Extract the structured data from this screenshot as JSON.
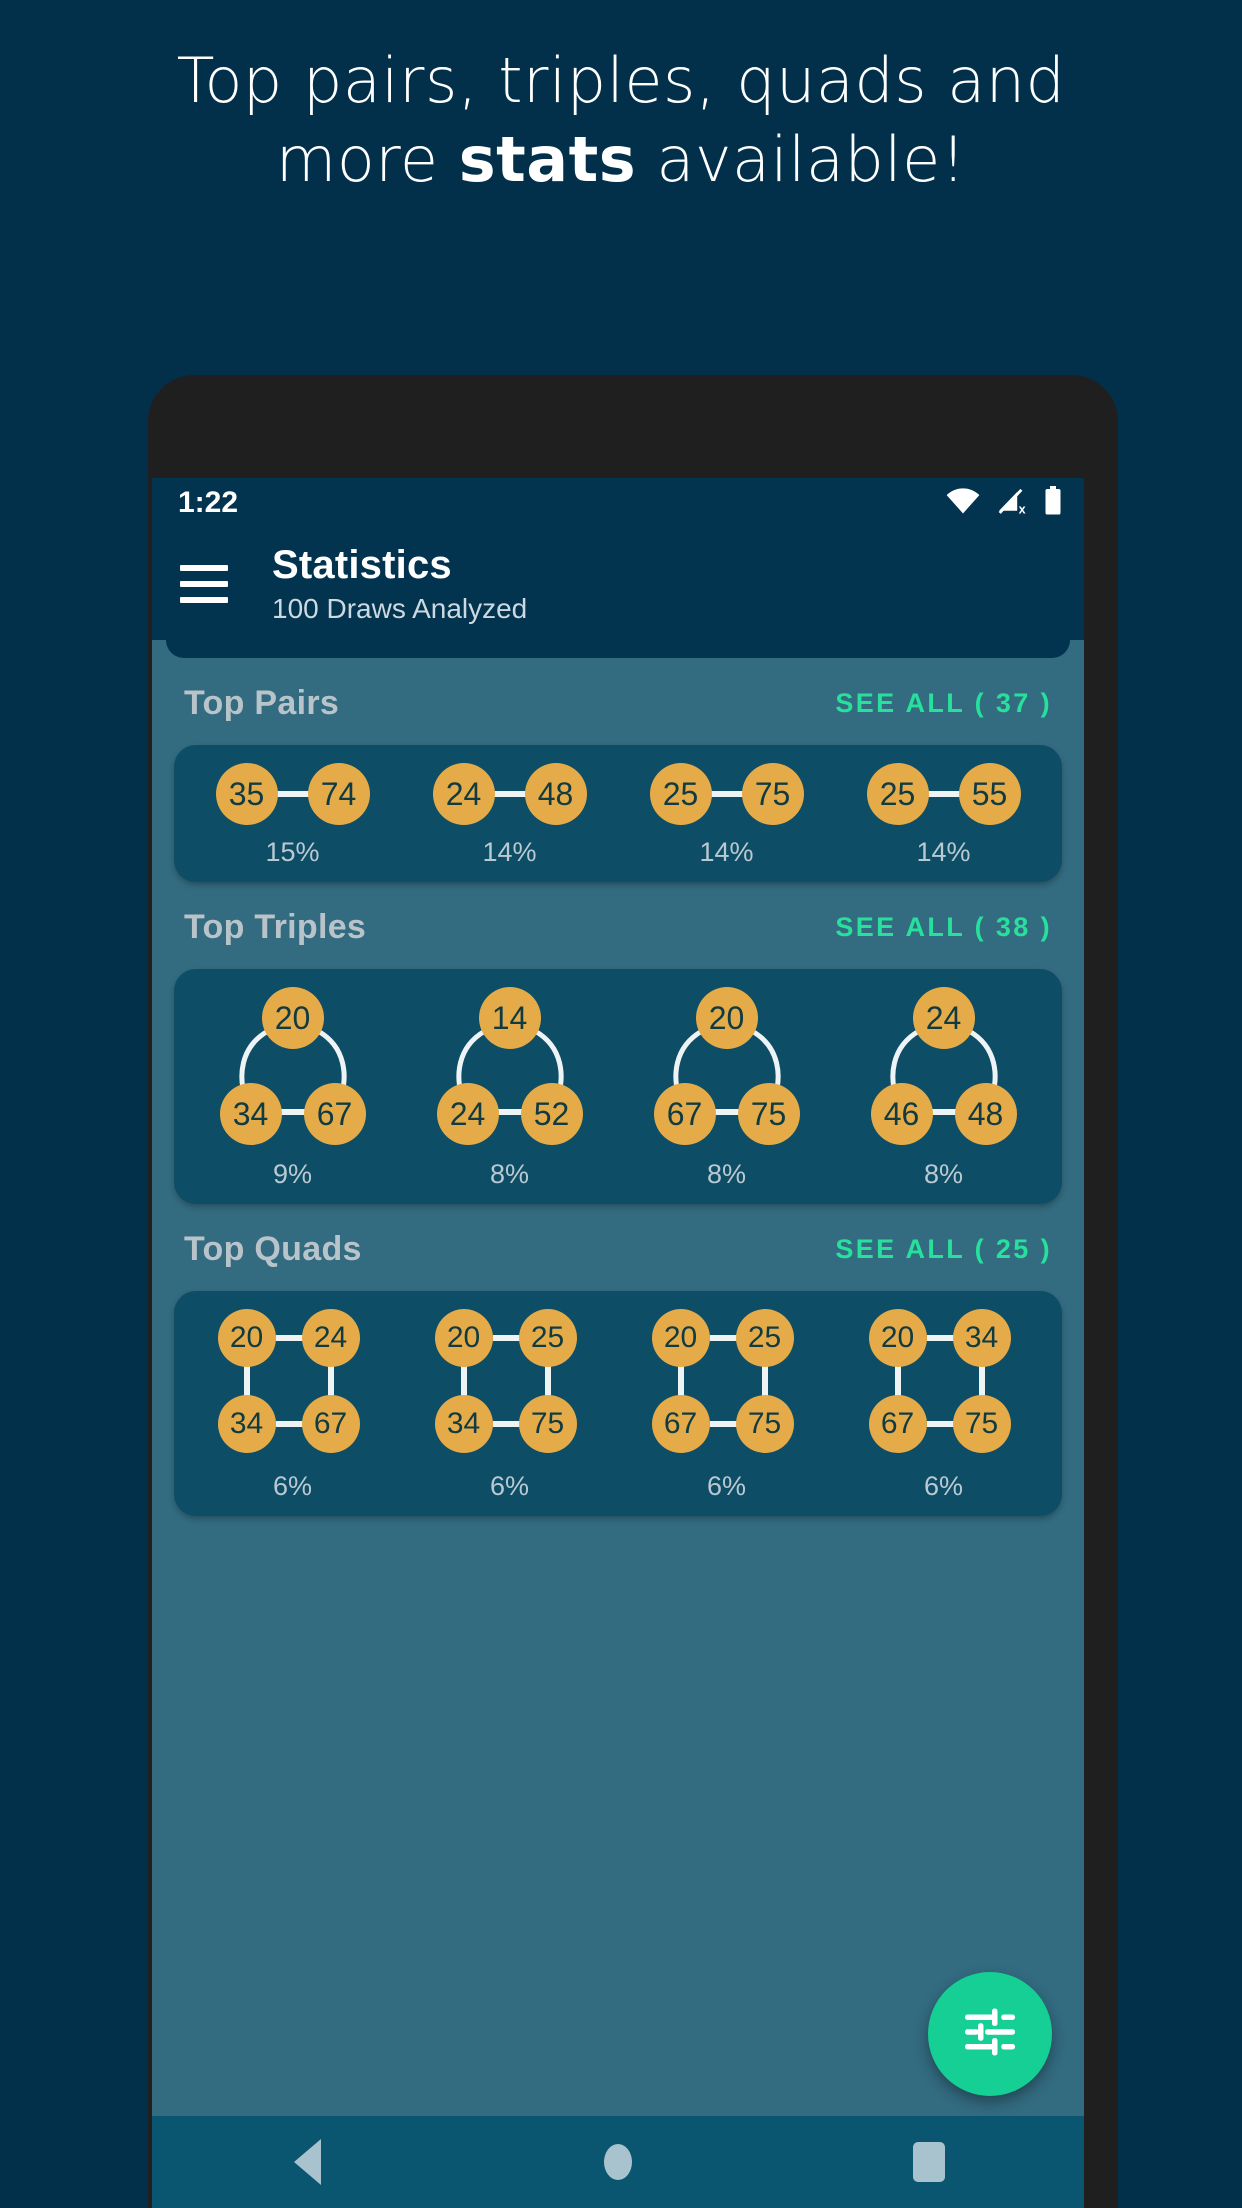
{
  "promo": {
    "line1": "Top pairs, triples, quads and",
    "line2_pre": "more ",
    "line2_bold": "stats",
    "line2_post": " available!"
  },
  "status_bar": {
    "time": "1:22",
    "icons": [
      "wifi-icon",
      "signal-off-icon",
      "battery-icon"
    ]
  },
  "app_bar": {
    "menu_icon": "hamburger-menu-icon",
    "title": "Statistics",
    "subtitle": "100 Draws Analyzed"
  },
  "colors": {
    "page_bg": "#02304a",
    "app_bar": "#02334f",
    "content_bg": "#336b80",
    "card_bg": "#0d4d66",
    "ball": "#e5ab48",
    "ball_text": "#113b42",
    "accent": "#27e09b",
    "fab": "#16cf94",
    "link": "#eef4f6",
    "nav_bar": "#0a5570"
  },
  "sections": [
    {
      "id": "top-pairs",
      "title": "Top Pairs",
      "see_all": "SEE ALL ( 37 )",
      "kind": "pair",
      "items": [
        {
          "numbers": [
            "35",
            "74"
          ],
          "percent": "15%"
        },
        {
          "numbers": [
            "24",
            "48"
          ],
          "percent": "14%"
        },
        {
          "numbers": [
            "25",
            "75"
          ],
          "percent": "14%"
        },
        {
          "numbers": [
            "25",
            "55"
          ],
          "percent": "14%"
        }
      ]
    },
    {
      "id": "top-triples",
      "title": "Top Triples",
      "see_all": "SEE ALL ( 38 )",
      "kind": "triple",
      "items": [
        {
          "numbers": [
            "20",
            "34",
            "67"
          ],
          "percent": "9%"
        },
        {
          "numbers": [
            "14",
            "24",
            "52"
          ],
          "percent": "8%"
        },
        {
          "numbers": [
            "20",
            "67",
            "75"
          ],
          "percent": "8%"
        },
        {
          "numbers": [
            "24",
            "46",
            "48"
          ],
          "percent": "8%"
        }
      ]
    },
    {
      "id": "top-quads",
      "title": "Top Quads",
      "see_all": "SEE ALL ( 25 )",
      "kind": "quad",
      "items": [
        {
          "numbers": [
            "20",
            "24",
            "34",
            "67"
          ],
          "percent": "6%"
        },
        {
          "numbers": [
            "20",
            "25",
            "34",
            "75"
          ],
          "percent": "6%"
        },
        {
          "numbers": [
            "20",
            "25",
            "67",
            "75"
          ],
          "percent": "6%"
        },
        {
          "numbers": [
            "20",
            "34",
            "67",
            "75"
          ],
          "percent": "6%"
        }
      ]
    }
  ],
  "fab": {
    "icon": "tune-sliders-icon"
  },
  "nav_bar": {
    "back": "back-triangle-icon",
    "home": "home-circle-icon",
    "recents": "recents-square-icon"
  }
}
